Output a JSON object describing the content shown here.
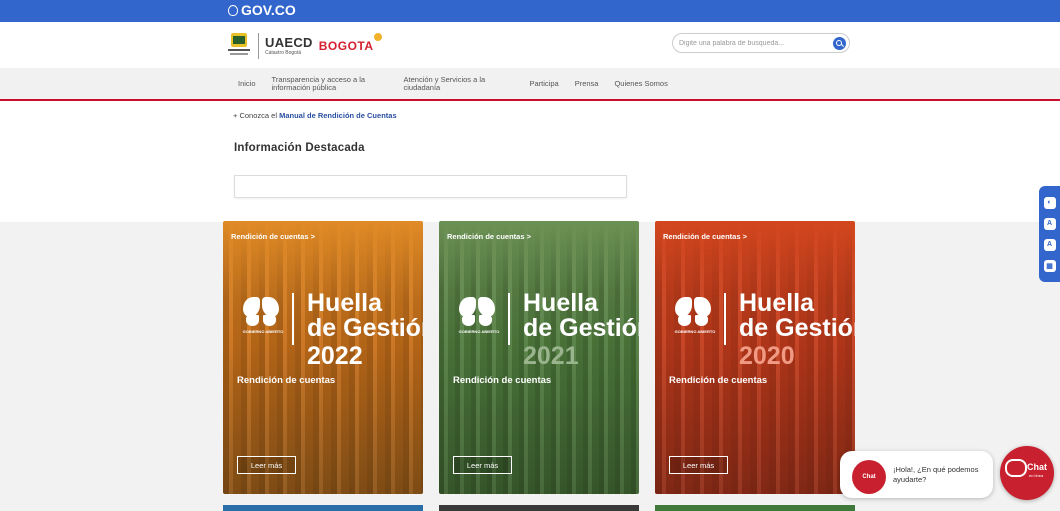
{
  "govbar": {
    "label": "GOV.CO"
  },
  "header": {
    "entity": "UAECD",
    "entity_sub": "Catastro Bogotá",
    "city": "BOGOTA",
    "search_placeholder": "Digite una palabra de busqueda..."
  },
  "nav": {
    "items": [
      {
        "label": "Inicio"
      },
      {
        "label": "Transparencia y acceso a la información pública"
      },
      {
        "label": "Atención y Servicios a la ciudadanía"
      },
      {
        "label": "Participa"
      },
      {
        "label": "Prensa"
      },
      {
        "label": "Quienes Somos"
      }
    ]
  },
  "content": {
    "manual_prefix": "+ Conozca el",
    "manual_link": "Manual de Rendición de Cuentas",
    "section_title": "Información Destacada"
  },
  "cards": [
    {
      "kicker": "Rendición de cuentas >",
      "logo_caption": "GOBIERNO ABIERTO",
      "title1": "Huella",
      "title2": "de Gestión",
      "year": "2022",
      "subtitle": "Rendición de cuentas",
      "button": "Leer más",
      "color": "#d9781c",
      "year_color": "#ffffff"
    },
    {
      "kicker": "Rendición de cuentas >",
      "logo_caption": "GOBIERNO ABIERTO",
      "title1": "Huella",
      "title2": "de Gestión",
      "year": "2021",
      "subtitle": "Rendición de cuentas",
      "button": "Leer más",
      "color": "#4e7d3b",
      "year_color": "#9ab48e"
    },
    {
      "kicker": "Rendición de cuentas >",
      "logo_caption": "GOBIERNO ABIERTO",
      "title1": "Huella",
      "title2": "de Gestión",
      "year": "2020",
      "subtitle": "Rendición de cuentas",
      "button": "Leer más",
      "color": "#c8401e",
      "year_color": "#f09a84"
    }
  ],
  "accessibility": {
    "buttons": [
      {
        "icon": "contrast-icon",
        "glyph": "◐"
      },
      {
        "icon": "font-decrease-icon",
        "glyph": "A"
      },
      {
        "icon": "font-increase-icon",
        "glyph": "A"
      },
      {
        "icon": "center-relevo-icon",
        "glyph": "▦"
      }
    ]
  },
  "chat": {
    "mini_label": "Chat",
    "message": "¡Hola!, ¿En qué podemos ayudarte?",
    "big_label": "Chat",
    "big_sub": "en línea"
  },
  "colors": {
    "gov_blue": "#3366cc",
    "nav_red": "#c8102e",
    "chat_red": "#c8202f"
  }
}
